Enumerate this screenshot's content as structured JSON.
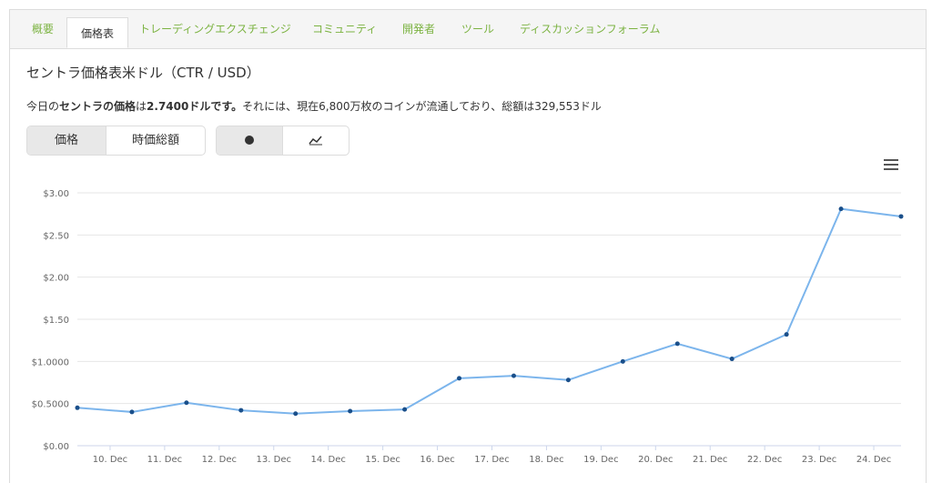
{
  "tabs": [
    {
      "label": "概要",
      "active": false
    },
    {
      "label": "価格表",
      "active": true
    },
    {
      "label": "トレーディングエクスチェンジ",
      "active": false
    },
    {
      "label": "コミュニティ",
      "active": false
    },
    {
      "label": "開発者",
      "active": false
    },
    {
      "label": "ツール",
      "active": false
    },
    {
      "label": "ディスカッションフォーラム",
      "active": false
    }
  ],
  "page": {
    "title": "セントラ価格表米ドル（CTR / USD）",
    "desc_prefix": "今日の",
    "desc_bold1": "セントラの価格",
    "desc_mid1": "は",
    "desc_bold2": "2.7400ドルです。",
    "desc_rest": "それには、現在6,800万枚のコインが流通しており、総額は329,553ドル"
  },
  "toggles": {
    "price_label": "価格",
    "marketcap_label": "時価総額",
    "dot_icon": "dot-icon",
    "line_icon": "line-chart-icon"
  },
  "colors": {
    "accent": "#7cb342",
    "line": "#7cb5ec",
    "point": "#1a4f8a"
  },
  "chart_data": {
    "type": "line",
    "title": "",
    "xlabel": "",
    "ylabel": "",
    "ylim": [
      0,
      3.0
    ],
    "y_ticks": [
      0,
      0.5,
      1.0,
      1.5,
      2.0,
      2.5,
      3.0
    ],
    "y_tick_labels": [
      "$0.00",
      "$0.5000",
      "$1.0000",
      "$1.50",
      "$2.00",
      "$2.50",
      "$3.00"
    ],
    "x_tick_labels": [
      "10. Dec",
      "11. Dec",
      "12. Dec",
      "13. Dec",
      "14. Dec",
      "15. Dec",
      "16. Dec",
      "17. Dec",
      "18. Dec",
      "19. Dec",
      "20. Dec",
      "21. Dec",
      "22. Dec",
      "23. Dec",
      "24. Dec"
    ],
    "x_tick_positions": [
      10.0,
      11.0,
      12.0,
      13.0,
      14.0,
      15.0,
      16.0,
      17.0,
      18.0,
      19.0,
      20.0,
      21.0,
      22.0,
      23.0,
      24.0
    ],
    "xlim": [
      9.4,
      24.5
    ],
    "grid": true,
    "legend": "none",
    "series": [
      {
        "x": [
          9.4,
          10.4,
          11.4,
          12.4,
          13.4,
          14.4,
          15.4,
          16.4,
          17.4,
          18.4,
          19.4,
          20.4,
          21.4,
          22.4,
          23.4,
          24.5
        ],
        "values": [
          0.45,
          0.4,
          0.51,
          0.42,
          0.38,
          0.41,
          0.43,
          0.8,
          0.83,
          0.78,
          1.0,
          1.21,
          1.03,
          1.32,
          2.81,
          2.72
        ]
      }
    ]
  }
}
